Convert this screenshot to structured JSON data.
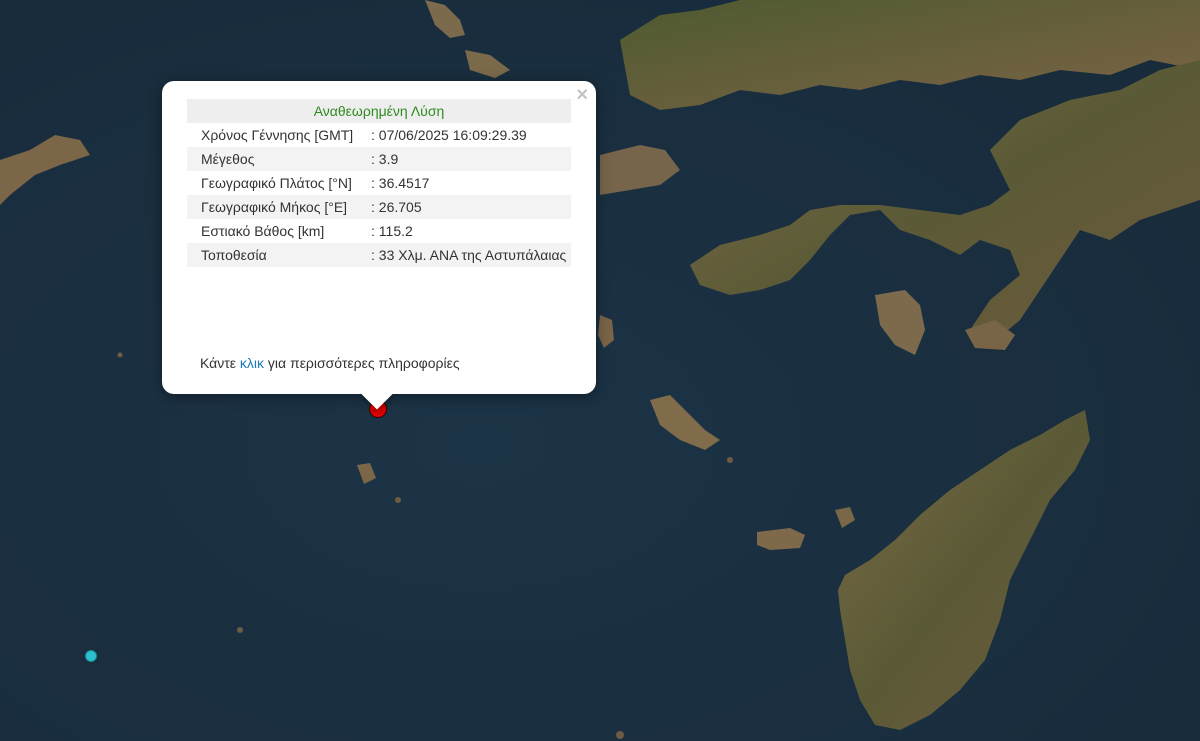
{
  "popup": {
    "title": "Αναθεωρημένη Λύση",
    "close_symbol": "×",
    "rows": [
      {
        "label": "Χρόνος Γέννησης [GMT]",
        "value": ": 07/06/2025 16:09:29.39"
      },
      {
        "label": "Μέγεθος",
        "value": ": 3.9"
      },
      {
        "label": "Γεωγραφικό Πλάτος [°N]",
        "value": ": 36.4517"
      },
      {
        "label": "Γεωγραφικό Μήκος [°E]",
        "value": ": 26.705"
      },
      {
        "label": "Εστιακό Βάθος [km]",
        "value": ": 115.2"
      },
      {
        "label": "Τοποθεσία",
        "value": ": 33 Χλμ. ΑΝΑ της Αστυπάλαιας"
      }
    ],
    "more_prefix": "Κάντε ",
    "more_link": "κλικ",
    "more_suffix": " για περισσότερες πληροφορίες"
  },
  "markers": {
    "selected_color": "#e00000",
    "other_color": "#2cc0d0",
    "selected_icon": "earthquake-marker-icon",
    "other_icon": "earthquake-marker-icon"
  },
  "colors": {
    "sea": "#1a2f40",
    "land": "#6b5a3e",
    "title_green": "#2f8b20",
    "link_blue": "#1b7ab8"
  }
}
